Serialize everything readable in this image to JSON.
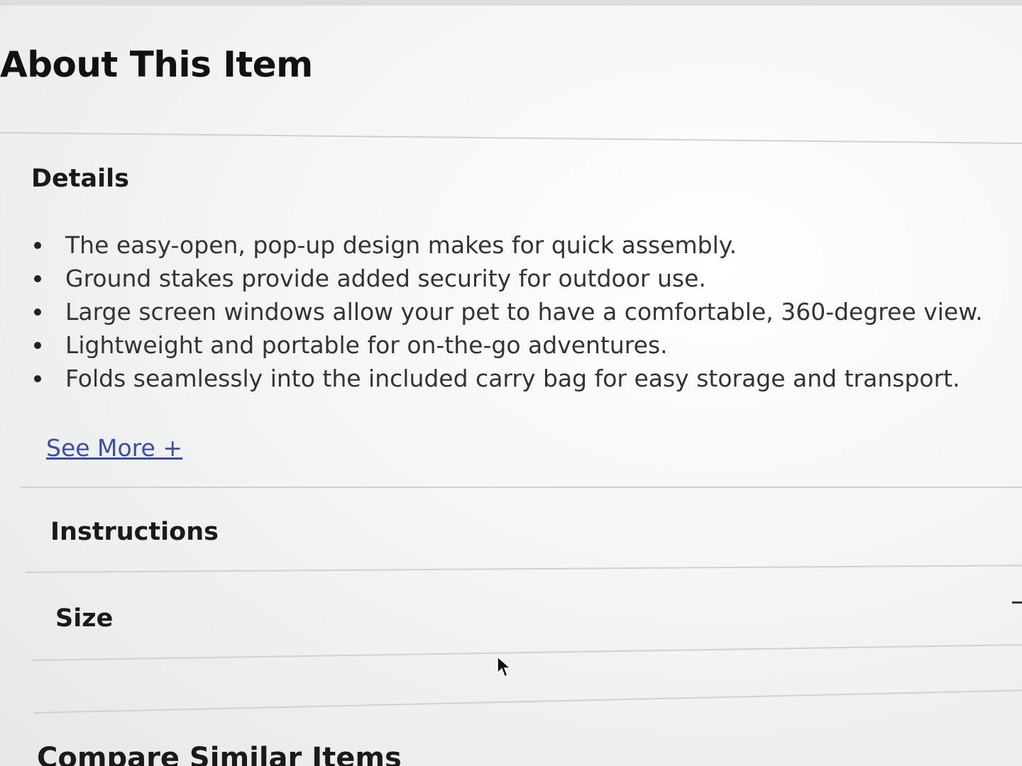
{
  "about": {
    "title": "About This Item"
  },
  "details": {
    "heading": "Details",
    "items": [
      "The easy-open, pop-up design makes for quick assembly.",
      "Ground stakes provide added security for outdoor use.",
      "Large screen windows allow your pet to have a comfortable, 360-degree view.",
      "Lightweight and portable for on-the-go adventures.",
      "Folds seamlessly into the included carry bag for easy storage and transport."
    ],
    "see_more_label": "See More +"
  },
  "sections": {
    "instructions": "Instructions",
    "size": "Size",
    "compare": "Compare Similar Items"
  },
  "icons": {
    "cursor": "mouse-pointer-icon"
  },
  "colors": {
    "link": "#3a4fa0",
    "text": "#222222",
    "divider": "#cfd2d1"
  }
}
